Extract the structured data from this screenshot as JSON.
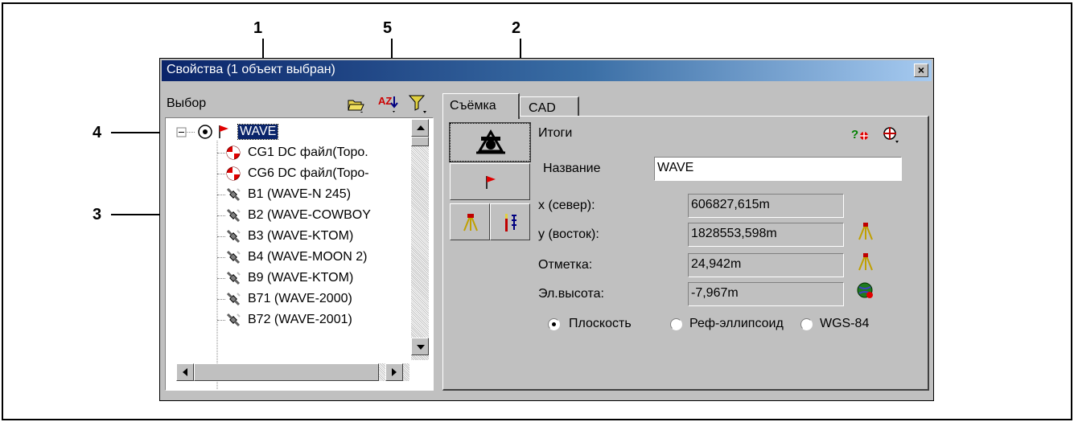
{
  "callouts": [
    "1",
    "5",
    "2",
    "4",
    "3"
  ],
  "dialog": {
    "title": "Свойства (1 объект выбран)",
    "close_glyph": "×"
  },
  "left": {
    "toolbar_label": "Выбор",
    "toolbar_icons": [
      "folder-open-icon",
      "sort-az-icon",
      "filter-icon"
    ],
    "sort_text": "AZ",
    "tree": [
      {
        "label": "WAVE",
        "icon": "flag-icon",
        "selected": true,
        "root": true
      },
      {
        "label": "CG1 DC файл(Topo.",
        "icon": "target-icon"
      },
      {
        "label": "CG6 DC файл(Topo-",
        "icon": "target-icon"
      },
      {
        "label": "B1 (WAVE-N 245)",
        "icon": "satellite-icon"
      },
      {
        "label": "B2 (WAVE-COWBOY",
        "icon": "satellite-icon"
      },
      {
        "label": "B3 (WAVE-KTOM)",
        "icon": "satellite-icon"
      },
      {
        "label": "B4 (WAVE-MOON 2)",
        "icon": "satellite-icon"
      },
      {
        "label": "B9 (WAVE-KTOM)",
        "icon": "satellite-icon"
      },
      {
        "label": "B71 (WAVE-2000)",
        "icon": "satellite-icon"
      },
      {
        "label": "B72 (WAVE-2001)",
        "icon": "satellite-icon"
      }
    ]
  },
  "right": {
    "tabs": [
      "Съёмка",
      "CAD"
    ],
    "section_title": "Итоги",
    "header_icons": [
      "help-add-icon",
      "target-menu-icon"
    ],
    "help_text": "?",
    "name_label": "Название",
    "name_value": "WAVE",
    "rows": [
      {
        "label": "x (север):",
        "value": "606827,615m",
        "icon": ""
      },
      {
        "label": "y (восток):",
        "value": "1828553,598m",
        "icon": "tripod-icon"
      },
      {
        "label": "Отметка:",
        "value": "24,942m",
        "icon": "tripod-icon"
      },
      {
        "label": "Эл.высота:",
        "value": "-7,967m",
        "icon": "globe-icon"
      }
    ],
    "radios": [
      {
        "label": "Плоскость",
        "checked": true
      },
      {
        "label": "Реф-эллипсоид",
        "checked": false
      },
      {
        "label": "WGS-84",
        "checked": false
      }
    ]
  },
  "colors": {
    "title_start": "#0a246a",
    "title_end": "#a6caf0",
    "face": "#c0c0c0",
    "select": "#0a246a"
  }
}
